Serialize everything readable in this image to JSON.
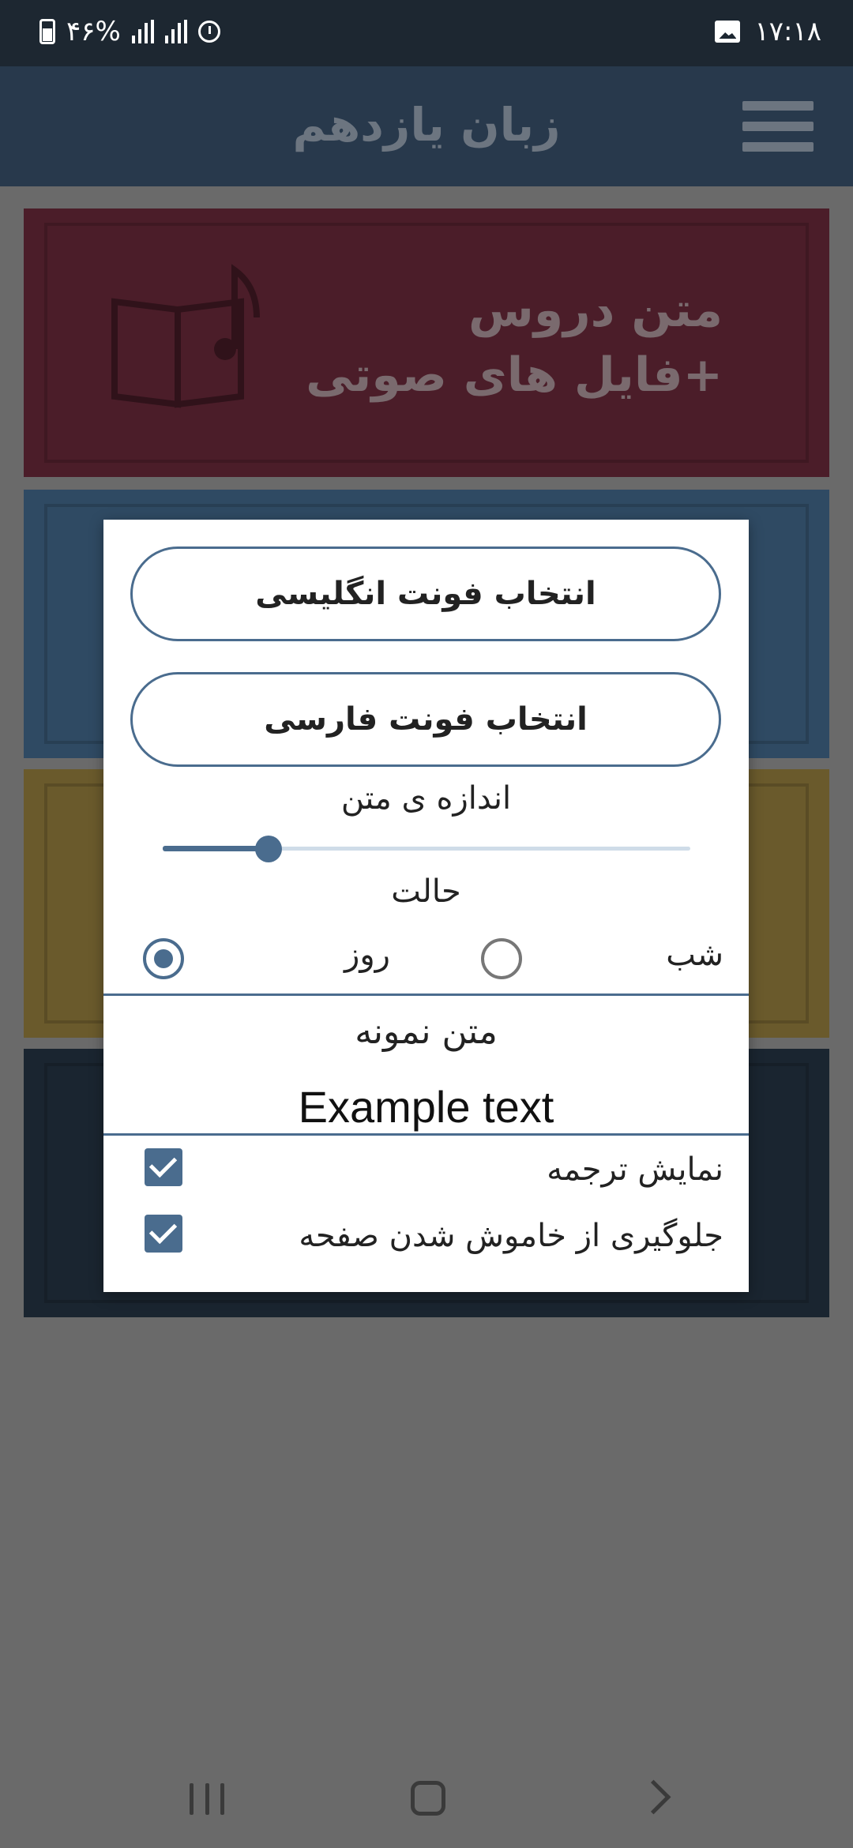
{
  "status_bar": {
    "battery": "۴۶%",
    "time": "۱۷:۱۸"
  },
  "app_bar": {
    "title": "زبان یازدهم"
  },
  "cards": [
    {
      "line1": "متن دروس",
      "line2": "+فایل های صوتی"
    }
  ],
  "dialog": {
    "english_font_button": "انتخاب فونت انگلیسی",
    "persian_font_button": "انتخاب فونت فارسی",
    "text_size_label": "اندازه ی متن",
    "text_size_value": 0.2,
    "mode_label": "حالت",
    "mode_night": "شب",
    "mode_day": "روز",
    "selected_mode": "day",
    "sample_persian": "متن نمونه",
    "sample_english": "Example text",
    "show_translation_label": "نمایش ترجمه",
    "show_translation_checked": true,
    "keep_screen_on_label": "جلوگیری از خاموش شدن صفحه",
    "keep_screen_on_checked": true
  },
  "colors": {
    "accent": "#4a6c8e",
    "appbar": "#28394c",
    "status_bar": "#1d2731"
  }
}
